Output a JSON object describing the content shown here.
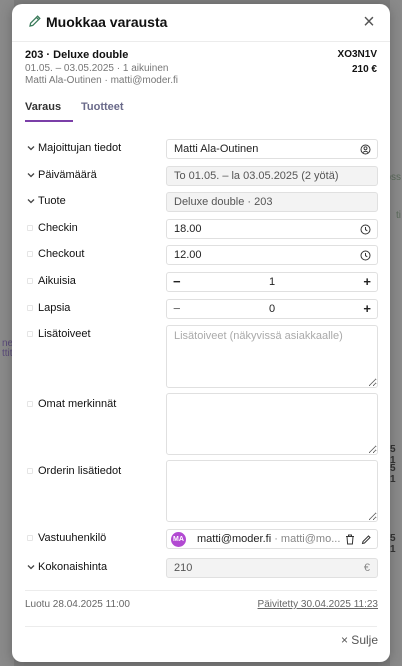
{
  "modal": {
    "title": "Muokkaa varausta",
    "icon": "pencil-icon",
    "close_icon": "close-icon"
  },
  "summary": {
    "title": "203 · Deluxe double",
    "dates": "01.05. – 03.05.2025 · 1 aikuinen",
    "guest": "Matti Ala-Outinen · matti@moder.fi",
    "code": "XO3N1V",
    "price": "210 €"
  },
  "tabs": [
    {
      "label": "Varaus",
      "active": true
    },
    {
      "label": "Tuotteet",
      "active": false
    }
  ],
  "fields": {
    "host": {
      "label": "Majoittujan tiedot",
      "value": "Matti Ala-Outinen"
    },
    "date": {
      "label": "Päivämäärä",
      "value": "To 01.05. – la 03.05.2025 (2 yötä)"
    },
    "product": {
      "label": "Tuote",
      "value": "Deluxe double · 203"
    },
    "checkin": {
      "label": "Checkin",
      "value": "18.00"
    },
    "checkout": {
      "label": "Checkout",
      "value": "12.00"
    },
    "adults": {
      "label": "Aikuisia",
      "value": "1",
      "minus": "−",
      "plus": "+"
    },
    "children": {
      "label": "Lapsia",
      "value": "0",
      "minus": "−",
      "plus": "+"
    },
    "extra": {
      "label": "Lisätoiveet",
      "placeholder": "Lisätoiveet (näkyvissä asiakkaalle)"
    },
    "own_notes": {
      "label": "Omat merkinnät"
    },
    "order_info": {
      "label": "Orderin lisätiedot"
    },
    "responsible": {
      "label": "Vastuuhenkilö",
      "initials": "MA",
      "email": "matti@moder.fi",
      "sub": " · matti@mo..."
    },
    "total": {
      "label": "Kokonaishinta",
      "value": "210",
      "currency": "€"
    }
  },
  "footer": {
    "created": "Luotu 28.04.2025 11:00",
    "updated": "Päivitetty 30.04.2025 11:23",
    "close_label": "× Sulje"
  },
  "background": {
    "left_fragments": [
      "nex",
      "ttit"
    ],
    "right_fragments": [
      "oss",
      "ti",
      "5 1",
      "5 1",
      "5 1"
    ]
  },
  "colors": {
    "accent": "#7b3fa8",
    "avatar": "#b24ad2"
  }
}
